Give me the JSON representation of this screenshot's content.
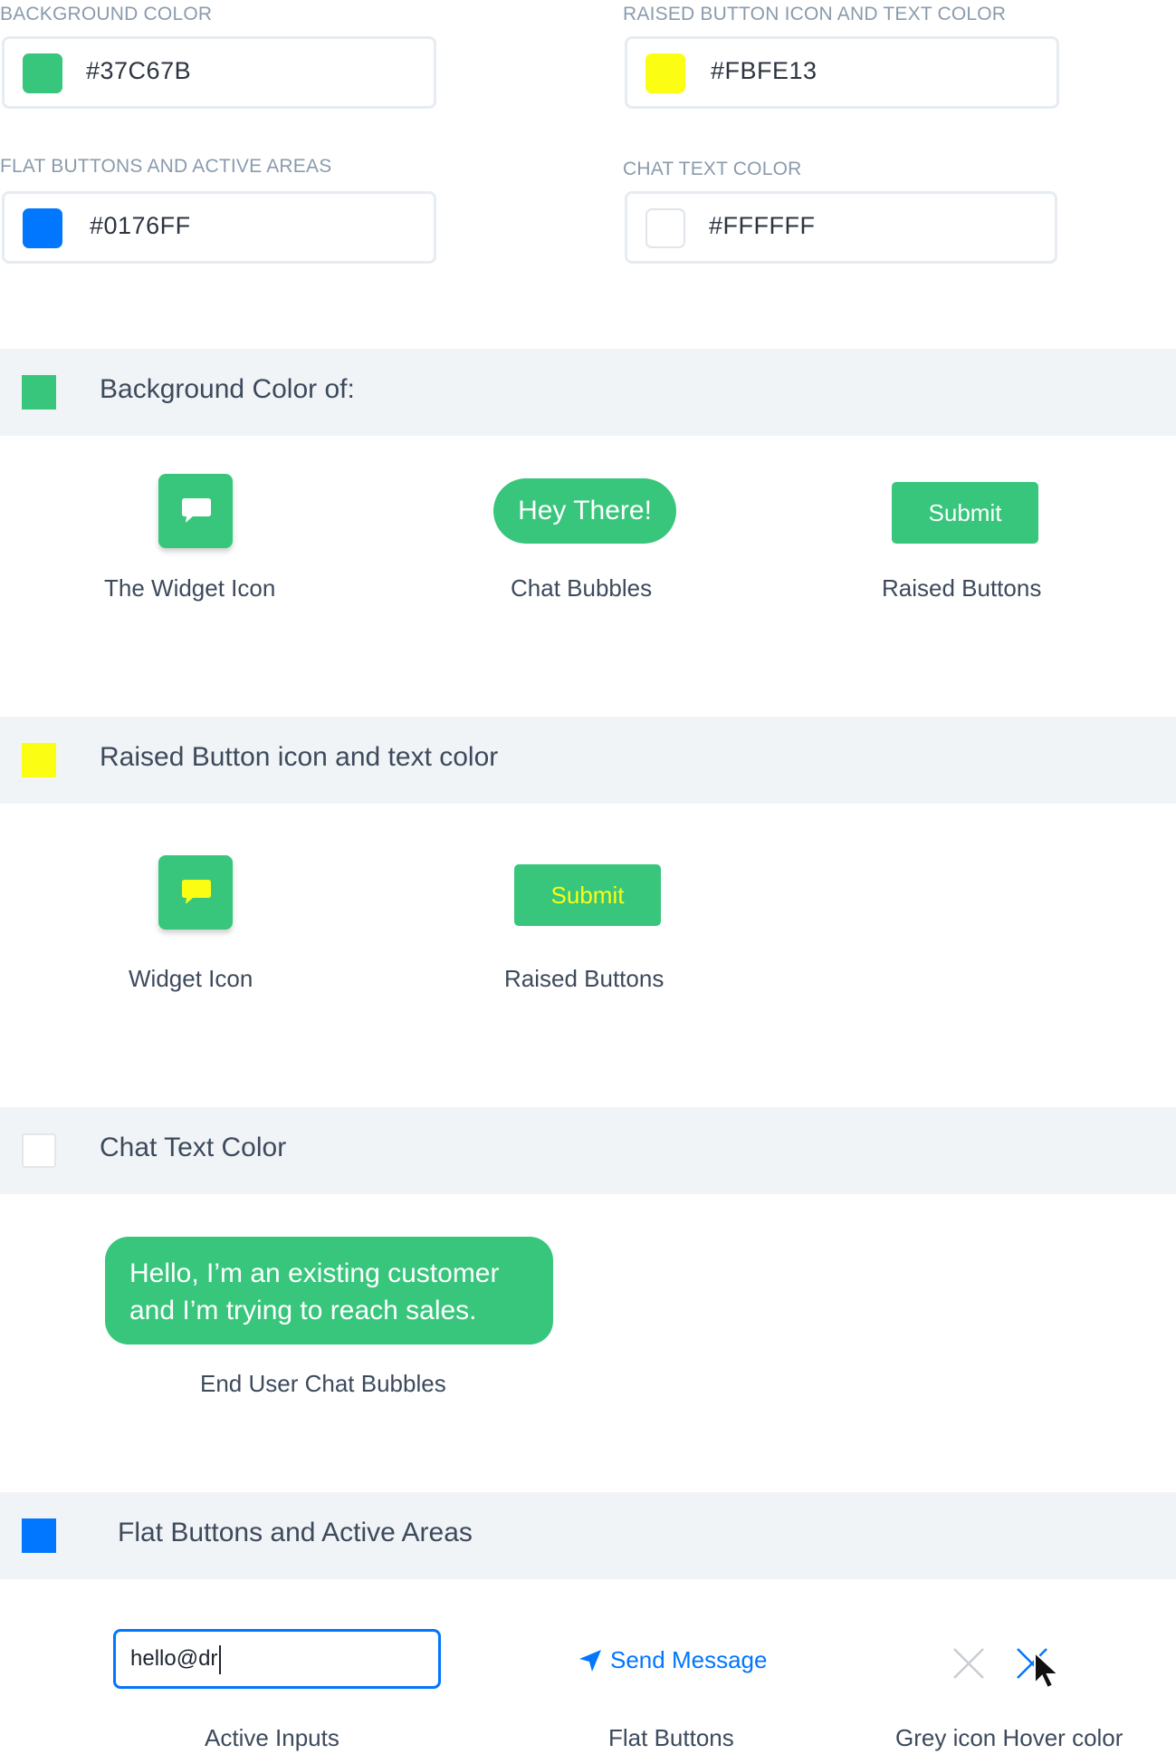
{
  "colors": {
    "background": "#37C67B",
    "raised_text": "#FBFE13",
    "flat_active": "#0176FF",
    "chat_text": "#FFFFFF",
    "section_bg": "#f1f4f7",
    "grey_icon": "#c8cdd2"
  },
  "pickers": {
    "background_color": {
      "label": "BACKGROUND COLOR",
      "value": "#37C67B"
    },
    "raised_button_color": {
      "label": "RAISED BUTTON ICON AND TEXT COLOR",
      "value": "#FBFE13"
    },
    "flat_buttons_color": {
      "label": "FLAT BUTTONS AND ACTIVE AREAS",
      "value": "#0176FF"
    },
    "chat_text_color": {
      "label": "CHAT TEXT COLOR",
      "value": "#FFFFFF"
    }
  },
  "sections": {
    "background": {
      "title": "Background Color of:",
      "widget_caption": "The Widget Icon",
      "bubble_text": "Hey There!",
      "bubble_caption": "Chat Bubbles",
      "button_label": "Submit",
      "button_caption": "Raised Buttons"
    },
    "raised": {
      "title": "Raised Button icon and text color",
      "widget_caption": "Widget Icon",
      "button_label": "Submit",
      "button_caption": "Raised Buttons"
    },
    "chat_text": {
      "title": "Chat Text Color",
      "bubble_line1": "Hello, I’m an existing customer",
      "bubble_line2": "and I’m trying to reach sales.",
      "bubble_caption": "End User Chat Bubbles"
    },
    "flat": {
      "title": "Flat Buttons and Active Areas",
      "input_value": "hello@dr",
      "input_caption": "Active Inputs",
      "flat_button_label": "Send Message",
      "flat_caption": "Flat Buttons",
      "hover_caption": "Grey icon Hover color"
    }
  },
  "icons": {
    "widget_icon": "chat-bubble-icon",
    "send_icon": "send-arrow-icon",
    "close_grey": "close-icon",
    "close_hover": "close-icon-hover",
    "cursor": "mouse-pointer-icon"
  }
}
